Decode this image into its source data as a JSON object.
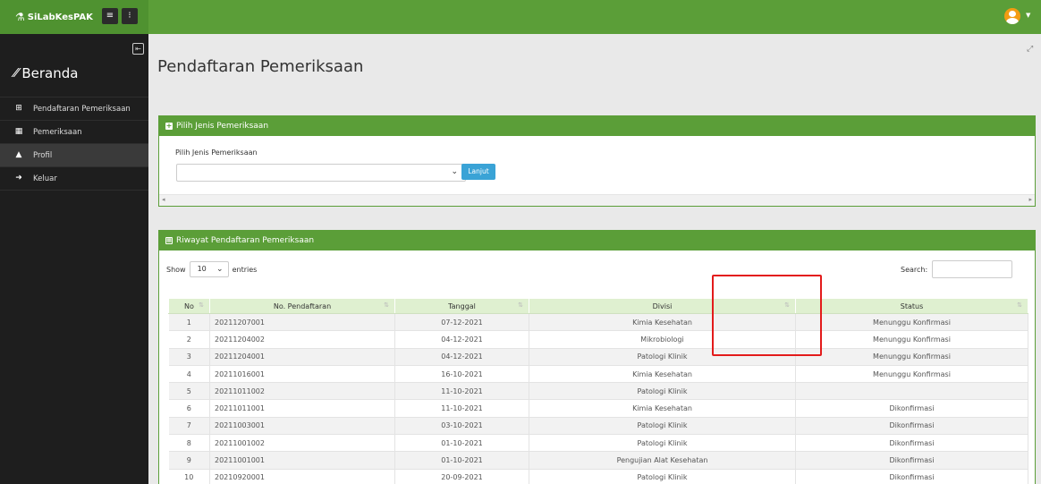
{
  "app": {
    "brand": "SiLabKesPAK"
  },
  "topbar": {
    "menu_btn": "≡",
    "info_btn": "⁝"
  },
  "sidebar": {
    "beranda": "Beranda",
    "items": [
      {
        "label": "Pendaftaran Pemeriksaan",
        "icon": "plus-square-icon"
      },
      {
        "label": "Pemeriksaan",
        "icon": "grid-icon"
      },
      {
        "label": "Profil",
        "icon": "user-icon"
      },
      {
        "label": "Keluar",
        "icon": "sign-out-icon"
      }
    ]
  },
  "page": {
    "title": "Pendaftaran Pemeriksaan"
  },
  "panel1": {
    "title": "Pilih Jenis Pemeriksaan",
    "label": "Pilih Jenis Pemeriksaan",
    "select_value": "",
    "button": "Lanjut"
  },
  "panel2": {
    "title": "Riwayat Pendaftaran Pemeriksaan",
    "show_label": "Show",
    "entries_value": "10",
    "entries_label": "entries",
    "search_label": "Search:",
    "columns": [
      "No",
      "No. Pendaftaran",
      "Tanggal",
      "Divisi",
      "Status"
    ],
    "rows": [
      {
        "no": "1",
        "no_pendaftaran": "20211207001",
        "tanggal": "07-12-2021",
        "divisi": "Kimia Kesehatan",
        "status": "Menunggu Konfirmasi"
      },
      {
        "no": "2",
        "no_pendaftaran": "20211204002",
        "tanggal": "04-12-2021",
        "divisi": "Mikrobiologi",
        "status": "Menunggu Konfirmasi"
      },
      {
        "no": "3",
        "no_pendaftaran": "20211204001",
        "tanggal": "04-12-2021",
        "divisi": "Patologi Klinik",
        "status": "Menunggu Konfirmasi"
      },
      {
        "no": "4",
        "no_pendaftaran": "20211016001",
        "tanggal": "16-10-2021",
        "divisi": "Kimia Kesehatan",
        "status": "Menunggu Konfirmasi"
      },
      {
        "no": "5",
        "no_pendaftaran": "20211011002",
        "tanggal": "11-10-2021",
        "divisi": "Patologi Klinik",
        "status": ""
      },
      {
        "no": "6",
        "no_pendaftaran": "20211011001",
        "tanggal": "11-10-2021",
        "divisi": "Kimia Kesehatan",
        "status": "Dikonfirmasi"
      },
      {
        "no": "7",
        "no_pendaftaran": "20211003001",
        "tanggal": "03-10-2021",
        "divisi": "Patologi Klinik",
        "status": "Dikonfirmasi"
      },
      {
        "no": "8",
        "no_pendaftaran": "20211001002",
        "tanggal": "01-10-2021",
        "divisi": "Patologi Klinik",
        "status": "Dikonfirmasi"
      },
      {
        "no": "9",
        "no_pendaftaran": "20211001001",
        "tanggal": "01-10-2021",
        "divisi": "Pengujian Alat Kesehatan",
        "status": "Dikonfirmasi"
      },
      {
        "no": "10",
        "no_pendaftaran": "20210920001",
        "tanggal": "20-09-2021",
        "divisi": "Patologi Klinik",
        "status": "Dikonfirmasi"
      }
    ]
  },
  "colors": {
    "brand_green": "#5b9e38",
    "sidebar_bg": "#1e1e1e",
    "button_blue": "#3aa3d6",
    "highlight_red": "#e31b1b"
  }
}
